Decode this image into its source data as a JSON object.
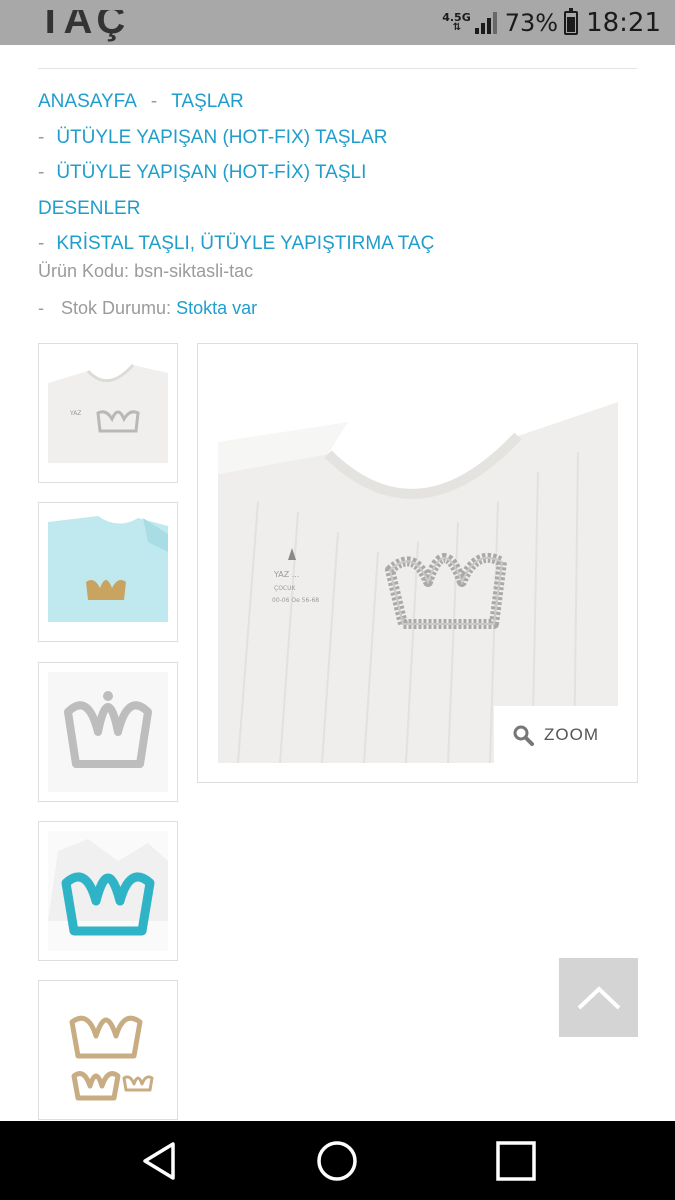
{
  "status_bar": {
    "network": "4.5G",
    "battery_percent": "73%",
    "battery_level": 0.73,
    "time": "18:21"
  },
  "page": {
    "title_partial": "TAÇ"
  },
  "breadcrumb": {
    "home": "ANASAYFA",
    "category": "TAŞLAR",
    "sub1": "ÜTÜYLE YAPIŞAN (HOT-FIX) TAŞLAR",
    "sub2_line1": "ÜTÜYLE YAPIŞAN (HOT-FİX) TAŞLI",
    "sub2_line2": "DESENLER",
    "current": "KRİSTAL TAŞLI, ÜTÜYLE YAPIŞTIRMA TAÇ"
  },
  "product": {
    "code_label": "Ürün Kodu:",
    "code_value": "bsn-siktasli-tac",
    "stock_label": "Stok Durumu:",
    "stock_value": "Stokta var"
  },
  "gallery": {
    "zoom_label": "ZOOM",
    "thumbnails": [
      "white-bodysuit-crown",
      "blue-bodysuit-gold-crown",
      "silver-crown",
      "turquoise-crown",
      "gold-crowns"
    ]
  },
  "colors": {
    "link": "#1f9ecc",
    "muted": "#9b9b9b",
    "status_bar": "#a8a8a8"
  }
}
